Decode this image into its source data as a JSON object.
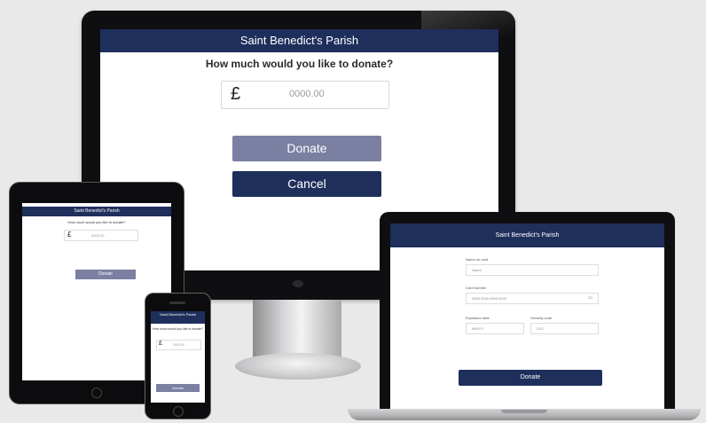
{
  "brand": {
    "primary_color": "#1f2f5c",
    "disabled_color": "#7b80a2"
  },
  "desktop": {
    "header_title": "Saint Benedict's Parish",
    "question": "How much would you like to donate?",
    "currency_symbol": "£",
    "amount_placeholder": "0000.00",
    "donate_label": "Donate",
    "cancel_label": "Cancel"
  },
  "tablet": {
    "header_title": "Saint Benedict's Parish",
    "question": "How much would you like to donate?",
    "currency_symbol": "£",
    "amount_placeholder": "0000.00",
    "donate_label": "Donate"
  },
  "phone": {
    "header_title": "Saint Benedict's Parish",
    "question": "How much would you like to donate?",
    "currency_symbol": "£",
    "amount_placeholder": "0000.00",
    "donate_label": "Donate"
  },
  "laptop": {
    "header_title": "Saint Benedict's Parish",
    "name_label": "Name on card",
    "name_value": "Name",
    "card_label": "Card number",
    "card_placeholder": "0000 0000 0000 0000",
    "expiry_label": "Expiration date",
    "expiry_value": "MM/YY",
    "cvc_label": "Security code",
    "cvc_value": "CVC",
    "donate_label": "Donate"
  }
}
